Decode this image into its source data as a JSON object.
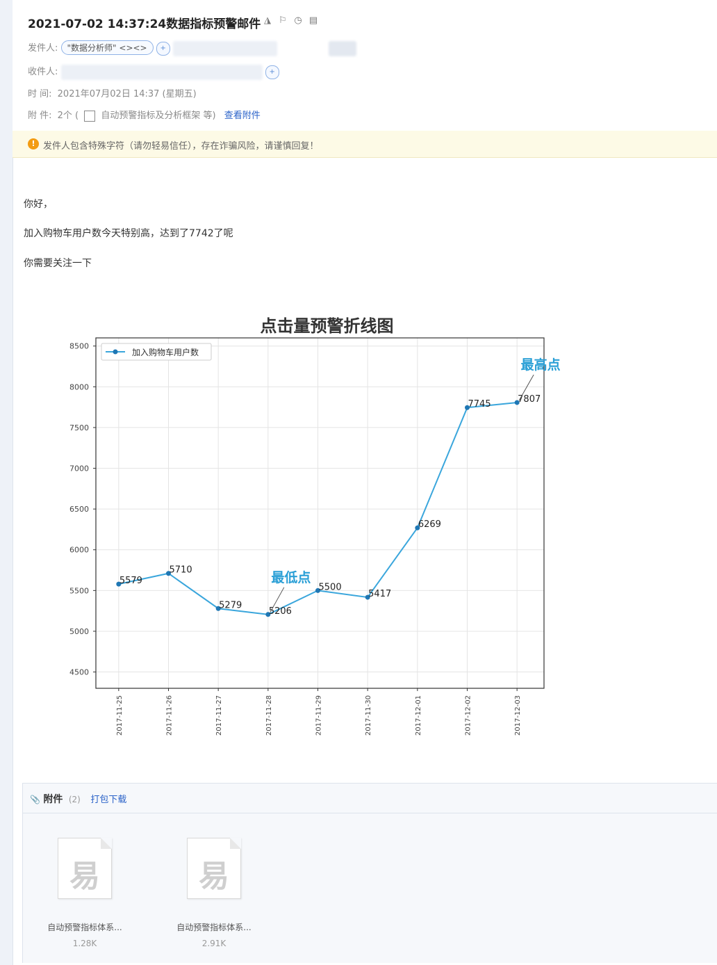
{
  "email": {
    "subject": "2021-07-02 14:37:24数据指标预警邮件",
    "from_label": "发件人:",
    "from_chip": "\"数据分析师\" <><>",
    "to_label": "收件人:",
    "time_label": "时    间:",
    "time_value": "2021年07月02日 14:37 (星期五)",
    "attach_label": "附    件:",
    "attach_value": "2个 (",
    "attach_names": "自动预警指标及分析框架 等)",
    "attach_link": "查看附件"
  },
  "warning": {
    "icon": "!",
    "text": "发件人包含特殊字符（请勿轻易信任），存在诈骗风险，请谨慎回复！"
  },
  "body": {
    "greeting": "你好，",
    "line1": "加入购物车用户数今天特别高，达到了7742了呢",
    "line2": "你需要关注一下"
  },
  "chart_data": {
    "type": "line",
    "title": "点击量预警折线图",
    "categories": [
      "2017-11-25",
      "2017-11-26",
      "2017-11-27",
      "2017-11-28",
      "2017-11-29",
      "2017-11-30",
      "2017-12-01",
      "2017-12-02",
      "2017-12-03"
    ],
    "series": [
      {
        "name": "加入购物车用户数",
        "values": [
          5579,
          5710,
          5279,
          5206,
          5500,
          5417,
          6269,
          7745,
          7807
        ],
        "color": "#3aa6dc"
      }
    ],
    "ylim": [
      4300,
      8600
    ],
    "yticks": [
      4500,
      5000,
      5500,
      6000,
      6500,
      7000,
      7500,
      8000,
      8500
    ],
    "grid": true,
    "legend": "top-left",
    "annotations": [
      {
        "text": "最高点",
        "index": 8
      },
      {
        "text": "最低点",
        "index": 3
      }
    ],
    "annotation_color": "#2a9fd6"
  },
  "attachments": {
    "title": "附件",
    "count": "(2)",
    "download_link": "打包下载",
    "files": [
      {
        "name": "自动预警指标体系...",
        "size": "1.28K",
        "icon": "file-icon"
      },
      {
        "name": "自动预警指标体系...",
        "size": "2.91K",
        "icon": "file-icon"
      }
    ]
  }
}
